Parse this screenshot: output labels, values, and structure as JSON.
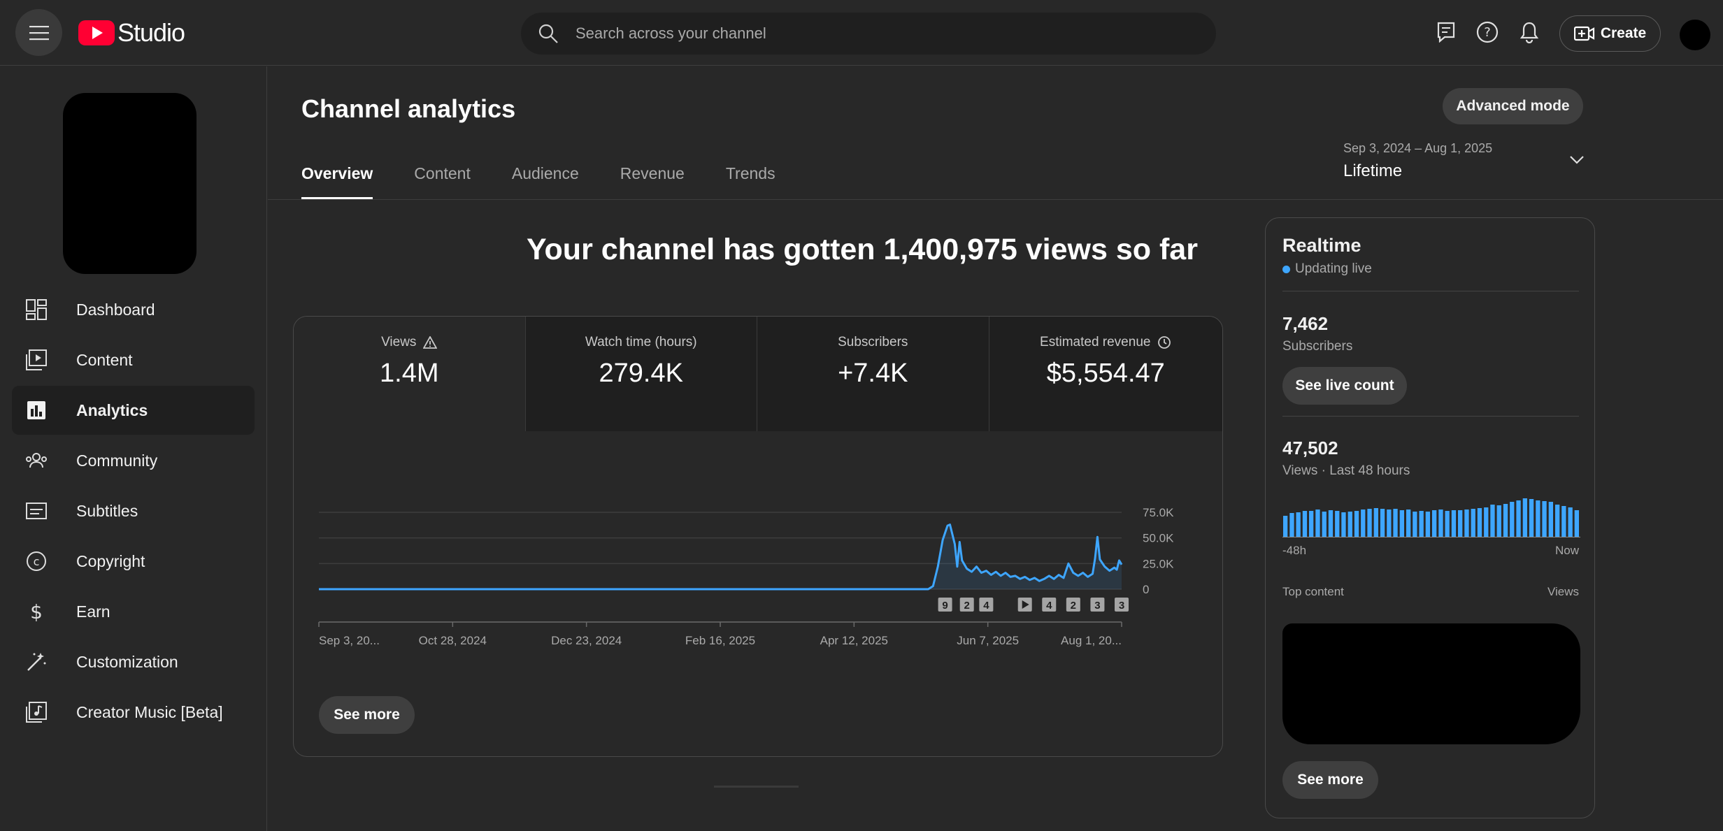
{
  "topbar": {
    "logo_text": "Studio",
    "search_placeholder": "Search across your channel",
    "create_label": "Create"
  },
  "sidebar": {
    "items": [
      {
        "label": "Dashboard",
        "icon": "dashboard-icon"
      },
      {
        "label": "Content",
        "icon": "content-icon"
      },
      {
        "label": "Analytics",
        "icon": "analytics-icon",
        "active": true
      },
      {
        "label": "Community",
        "icon": "community-icon"
      },
      {
        "label": "Subtitles",
        "icon": "subtitles-icon"
      },
      {
        "label": "Copyright",
        "icon": "copyright-icon"
      },
      {
        "label": "Earn",
        "icon": "earn-icon"
      },
      {
        "label": "Customization",
        "icon": "customization-icon"
      },
      {
        "label": "Creator Music [Beta]",
        "icon": "creator-music-icon"
      }
    ]
  },
  "page": {
    "title": "Channel analytics",
    "advanced_mode": "Advanced mode",
    "tabs": [
      "Overview",
      "Content",
      "Audience",
      "Revenue",
      "Trends"
    ],
    "active_tab": "Overview",
    "date_range_sub": "Sep 3, 2024 – Aug 1, 2025",
    "date_range_main": "Lifetime",
    "headline": "Your channel has gotten 1,400,975 views so far"
  },
  "metrics": [
    {
      "label": "Views",
      "value": "1.4M",
      "icon": "warning-icon",
      "active": true
    },
    {
      "label": "Watch time (hours)",
      "value": "279.4K"
    },
    {
      "label": "Subscribers",
      "value": "+7.4K"
    },
    {
      "label": "Estimated revenue",
      "value": "$5,554.47",
      "icon": "clock-icon"
    }
  ],
  "chart_data": {
    "type": "area",
    "y_ticks": [
      "75.0K",
      "50.0K",
      "25.0K",
      "0"
    ],
    "ylim": [
      0,
      75000
    ],
    "x_ticks": [
      "Sep 3, 20...",
      "Oct 28, 2024",
      "Dec 23, 2024",
      "Feb 16, 2025",
      "Apr 12, 2025",
      "Jun 7, 2025",
      "Aug 1, 20..."
    ],
    "x_start": "2024-09-03",
    "x_end": "2025-08-01",
    "color": "#3ea6ff",
    "series": [
      {
        "points": [
          [
            "2024-09-03",
            0
          ],
          [
            "2025-05-13",
            0
          ],
          [
            "2025-05-15",
            3000
          ],
          [
            "2025-05-17",
            22000
          ],
          [
            "2025-05-19",
            48000
          ],
          [
            "2025-05-21",
            62000
          ],
          [
            "2025-05-22",
            63000
          ],
          [
            "2025-05-24",
            44000
          ],
          [
            "2025-05-25",
            22000
          ],
          [
            "2025-05-26",
            46000
          ],
          [
            "2025-05-27",
            28000
          ],
          [
            "2025-05-29",
            20000
          ],
          [
            "2025-05-31",
            17000
          ],
          [
            "2025-06-02",
            22000
          ],
          [
            "2025-06-04",
            16000
          ],
          [
            "2025-06-06",
            18000
          ],
          [
            "2025-06-08",
            14000
          ],
          [
            "2025-06-10",
            17000
          ],
          [
            "2025-06-12",
            13000
          ],
          [
            "2025-06-14",
            16000
          ],
          [
            "2025-06-16",
            12000
          ],
          [
            "2025-06-18",
            13000
          ],
          [
            "2025-06-20",
            10000
          ],
          [
            "2025-06-22",
            12000
          ],
          [
            "2025-06-24",
            9000
          ],
          [
            "2025-06-26",
            11000
          ],
          [
            "2025-06-28",
            8000
          ],
          [
            "2025-06-30",
            10000
          ],
          [
            "2025-07-02",
            13000
          ],
          [
            "2025-07-04",
            10000
          ],
          [
            "2025-07-06",
            14000
          ],
          [
            "2025-07-08",
            11000
          ],
          [
            "2025-07-10",
            25000
          ],
          [
            "2025-07-12",
            16000
          ],
          [
            "2025-07-14",
            13000
          ],
          [
            "2025-07-16",
            16000
          ],
          [
            "2025-07-18",
            12000
          ],
          [
            "2025-07-20",
            15000
          ],
          [
            "2025-07-21",
            30000
          ],
          [
            "2025-07-22",
            51000
          ],
          [
            "2025-07-23",
            29000
          ],
          [
            "2025-07-25",
            22000
          ],
          [
            "2025-07-27",
            18000
          ],
          [
            "2025-07-29",
            21000
          ],
          [
            "2025-07-30",
            19000
          ],
          [
            "2025-07-31",
            28000
          ],
          [
            "2025-08-01",
            24000
          ]
        ]
      }
    ],
    "annotations": [
      {
        "date": "2025-05-20",
        "label": "9"
      },
      {
        "date": "2025-05-29",
        "label": "2"
      },
      {
        "date": "2025-06-06",
        "label": "4"
      },
      {
        "date": "2025-06-22",
        "label": "play"
      },
      {
        "date": "2025-07-02",
        "label": "4"
      },
      {
        "date": "2025-07-12",
        "label": "2"
      },
      {
        "date": "2025-07-22",
        "label": "3"
      },
      {
        "date": "2025-08-01",
        "label": "3"
      }
    ]
  },
  "card": {
    "see_more": "See more"
  },
  "realtime": {
    "title": "Realtime",
    "live_label": "Updating live",
    "subscribers_value": "7,462",
    "subscribers_label": "Subscribers",
    "see_live_count": "See live count",
    "views_value": "47,502",
    "views_label": "Views · Last 48 hours",
    "axis_start": "-48h",
    "axis_end": "Now",
    "top_content_label": "Top content",
    "top_content_col": "Views",
    "see_more": "See more",
    "bar_color": "#3ea6ff",
    "bars": [
      30,
      34,
      35,
      37,
      37,
      39,
      36,
      38,
      37,
      35,
      36,
      37,
      39,
      40,
      41,
      40,
      39,
      40,
      38,
      39,
      36,
      37,
      36,
      38,
      39,
      37,
      38,
      38,
      39,
      40,
      41,
      42,
      46,
      45,
      47,
      50,
      52,
      55,
      54,
      52,
      51,
      50,
      46,
      44,
      42,
      38
    ]
  }
}
